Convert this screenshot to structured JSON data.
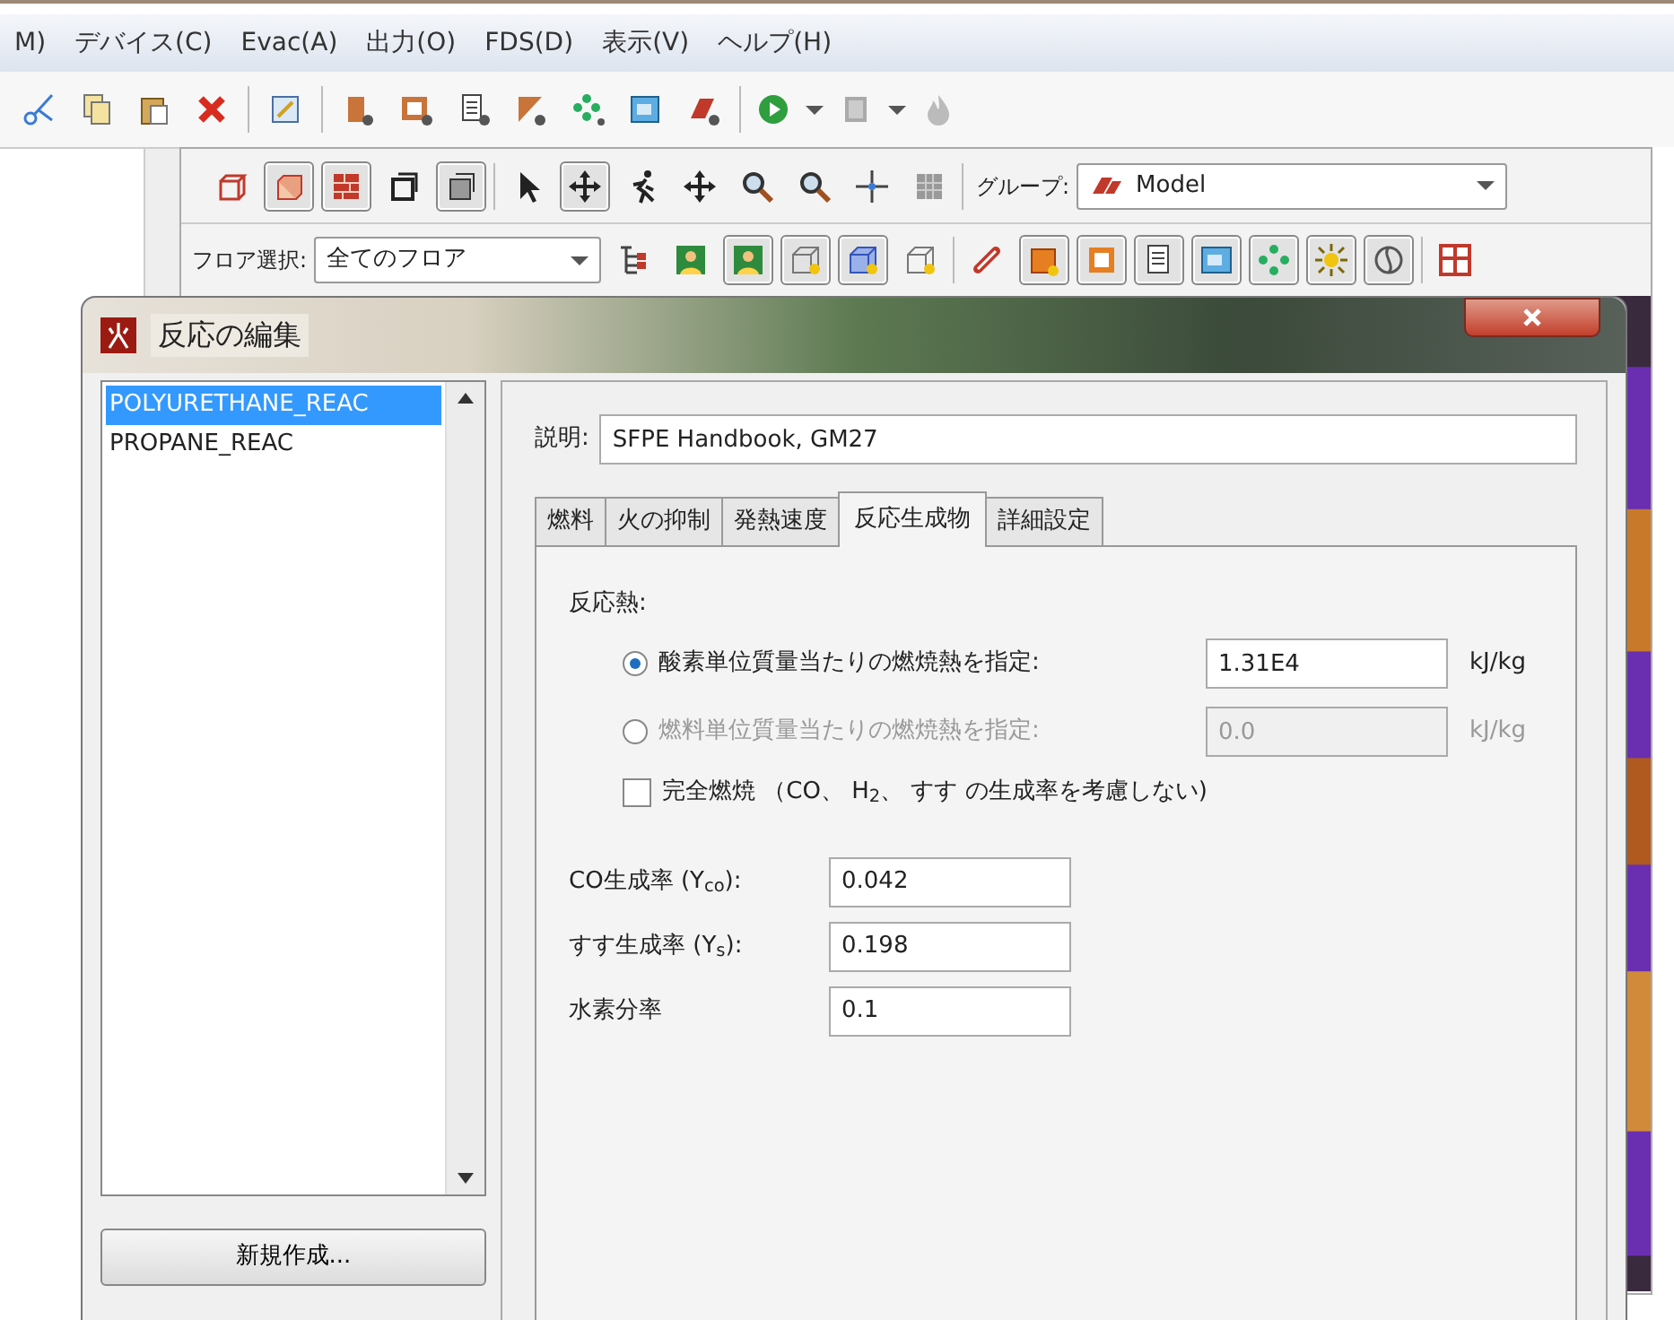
{
  "menu": [
    "M)",
    "デバイス(C)",
    "Evac(A)",
    "出力(O)",
    "FDS(D)",
    "表示(V)",
    "ヘルプ(H)"
  ],
  "view_tools": [
    {
      "pressed": false
    },
    {
      "pressed": true
    },
    {
      "pressed": true
    },
    {
      "pressed": false
    },
    {
      "pressed": true
    }
  ],
  "edit_tools": [
    {
      "pressed": false
    },
    {
      "pressed": true
    },
    {
      "pressed": false
    },
    {
      "pressed": false
    },
    {
      "pressed": false
    },
    {
      "pressed": false
    },
    {
      "pressed": false
    },
    {
      "pressed": false
    }
  ],
  "group": {
    "label": "グループ:",
    "value": "Model"
  },
  "floor": {
    "label": "フロア選択:",
    "value": "全てのフロア"
  },
  "floor_tools": [
    {
      "pressed": false
    },
    {
      "pressed": false
    },
    {
      "pressed": true
    },
    {
      "pressed": true
    },
    {
      "pressed": true
    },
    {
      "pressed": false
    },
    {
      "pressed": false
    },
    {
      "pressed": true
    },
    {
      "pressed": true
    },
    {
      "pressed": true
    },
    {
      "pressed": true
    },
    {
      "pressed": true
    },
    {
      "pressed": true
    },
    {
      "pressed": true
    },
    {
      "pressed": false
    }
  ],
  "dialog": {
    "title": "反応の編集",
    "reactions": [
      {
        "name": "POLYURETHANE_REAC",
        "selected": true
      },
      {
        "name": "PROPANE_REAC",
        "selected": false
      }
    ],
    "new_button": "新規作成...",
    "description_label": "説明:",
    "description": "SFPE Handbook, GM27",
    "tabs": [
      {
        "label": "燃料",
        "selected": false
      },
      {
        "label": "火の抑制",
        "selected": false
      },
      {
        "label": "発熱速度",
        "selected": false
      },
      {
        "label": "反応生成物",
        "selected": true
      },
      {
        "label": "詳細設定",
        "selected": false
      }
    ],
    "heat_label": "反応熱:",
    "heat_options": [
      {
        "label": "酸素単位質量当たりの燃焼熱を指定:",
        "selected": true,
        "value": "1.31E4",
        "unit": "kJ/kg",
        "disabled": false
      },
      {
        "label": "燃料単位質量当たりの燃焼熱を指定:",
        "selected": false,
        "value": "0.0",
        "unit": "kJ/kg",
        "disabled": true
      }
    ],
    "complete_combustion": {
      "label": "完全燃焼 （CO、 H$_{2}$、 すす の生成率を考慮しない)",
      "checked": false
    },
    "yields": [
      {
        "label": "CO生成率 (Y$_{co}$):",
        "value": "0.042"
      },
      {
        "label": "すす生成率 (Y$_{s}$):",
        "value": "0.198"
      },
      {
        "label": "水素分率",
        "value": "0.1"
      }
    ]
  }
}
